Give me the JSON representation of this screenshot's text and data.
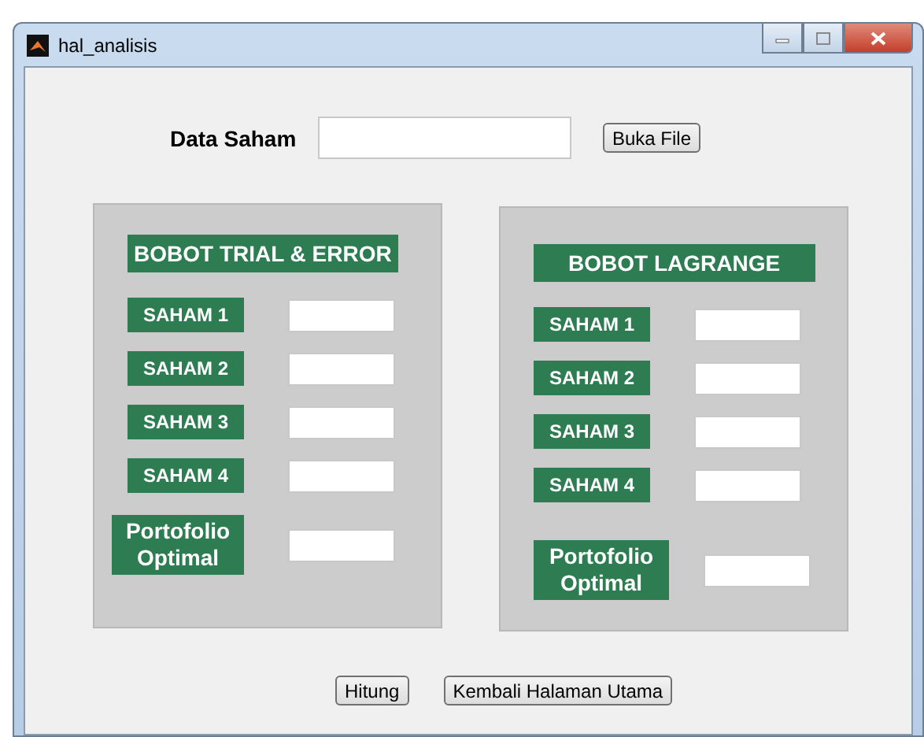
{
  "window": {
    "title": "hal_analisis"
  },
  "data_row": {
    "label": "Data Saham",
    "button": "Buka File"
  },
  "panels": [
    {
      "title": "BOBOT TRIAL & ERROR",
      "rows": [
        {
          "label": "SAHAM 1"
        },
        {
          "label": "SAHAM 2"
        },
        {
          "label": "SAHAM 3"
        },
        {
          "label": "SAHAM 4"
        }
      ],
      "result_label": "Portofolio Optimal"
    },
    {
      "title": "BOBOT LAGRANGE",
      "rows": [
        {
          "label": "SAHAM 1"
        },
        {
          "label": "SAHAM 2"
        },
        {
          "label": "SAHAM 3"
        },
        {
          "label": "SAHAM 4"
        }
      ],
      "result_label": "Portofolio Optimal"
    }
  ],
  "buttons": [
    "Hitung",
    "Kembali Halaman Utama"
  ]
}
